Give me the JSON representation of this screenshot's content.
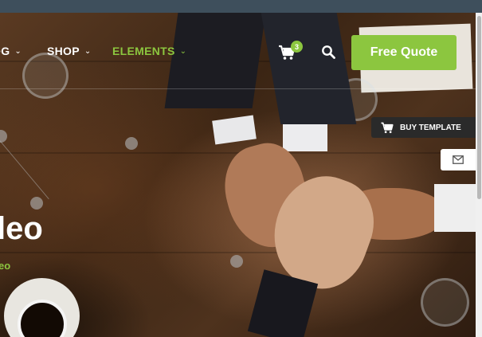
{
  "nav": {
    "items": [
      {
        "label": "OG",
        "active": false
      },
      {
        "label": "SHOP",
        "active": false
      },
      {
        "label": "ELEMENTS",
        "active": true
      }
    ]
  },
  "header": {
    "cart_count": "3",
    "quote_label": "Free Quote"
  },
  "side": {
    "buy_template_label": "BUY TEMPLATE"
  },
  "hero": {
    "title": "leo",
    "subtitle": "eo"
  },
  "icons": {
    "cart": "cart-icon",
    "search": "search-icon",
    "buy": "cart-icon",
    "mail": "envelope-icon",
    "chevron": "chevron-down-icon"
  },
  "colors": {
    "accent": "#8cc63f",
    "topbar": "#3e4f5c",
    "dark_button": "#2a2a2a"
  }
}
